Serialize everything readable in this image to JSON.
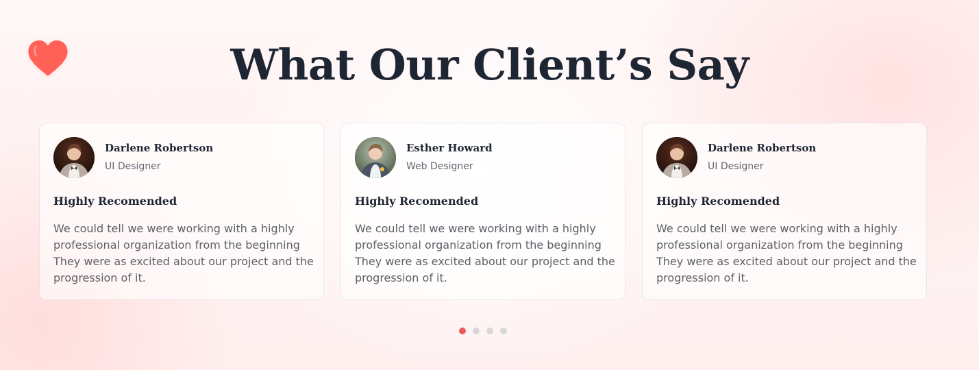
{
  "theme": {
    "accent": "#f05a5a",
    "heading": "#1f2633",
    "text": "#5b5f67",
    "dot_inactive": "#d8d8da"
  },
  "decor": {
    "icon": "heart-icon"
  },
  "section": {
    "title": "What Our Client’s Say"
  },
  "testimonials": [
    {
      "name": "Darlene Robertson",
      "role": "UI Designer",
      "headline": "Highly Recomended",
      "text": "We could tell we were working with a highly professional organization from the beginning They were as excited about our project and the progression of it."
    },
    {
      "name": "Esther Howard",
      "role": "Web Designer",
      "headline": "Highly Recomended",
      "text": "We could tell we were working with a highly professional organization from the beginning They were as excited about our project and the progression of it."
    },
    {
      "name": "Darlene Robertson",
      "role": "UI Designer",
      "headline": "Highly Recomended",
      "text": "We could tell we were working with a highly professional organization from the beginning They were as excited about our project and the progression of it."
    }
  ],
  "pagination": {
    "count": 4,
    "active_index": 0
  }
}
